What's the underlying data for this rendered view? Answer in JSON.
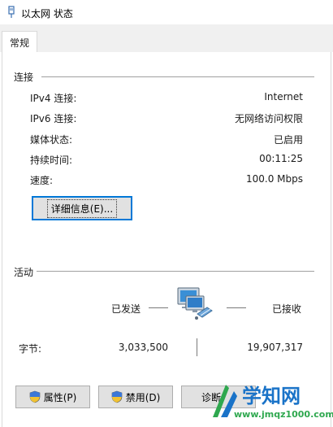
{
  "window": {
    "title": "以太网 状态"
  },
  "tabs": [
    {
      "label": "常规"
    }
  ],
  "connection": {
    "section_title": "连接",
    "rows": [
      {
        "label": "IPv4 连接:",
        "value": "Internet"
      },
      {
        "label": "IPv6 连接:",
        "value": "无网络访问权限"
      },
      {
        "label": "媒体状态:",
        "value": "已启用"
      },
      {
        "label": "持续时间:",
        "value": "00:11:25"
      },
      {
        "label": "速度:",
        "value": "100.0 Mbps"
      }
    ],
    "details_button": "详细信息(E)..."
  },
  "activity": {
    "section_title": "活动",
    "sent_label": "已发送",
    "received_label": "已接收",
    "bytes_label": "字节:",
    "bytes_sent": "3,033,500",
    "bytes_received": "19,907,317"
  },
  "buttons": {
    "properties": "属性(P)",
    "disable": "禁用(D)",
    "diagnose": "诊断"
  },
  "watermark": {
    "main": "学知网",
    "url": "www.jmqz1000.com"
  },
  "colors": {
    "accent": "#0078d7",
    "watermark_blue": "#1a73c8",
    "watermark_green": "#2fa84f"
  }
}
